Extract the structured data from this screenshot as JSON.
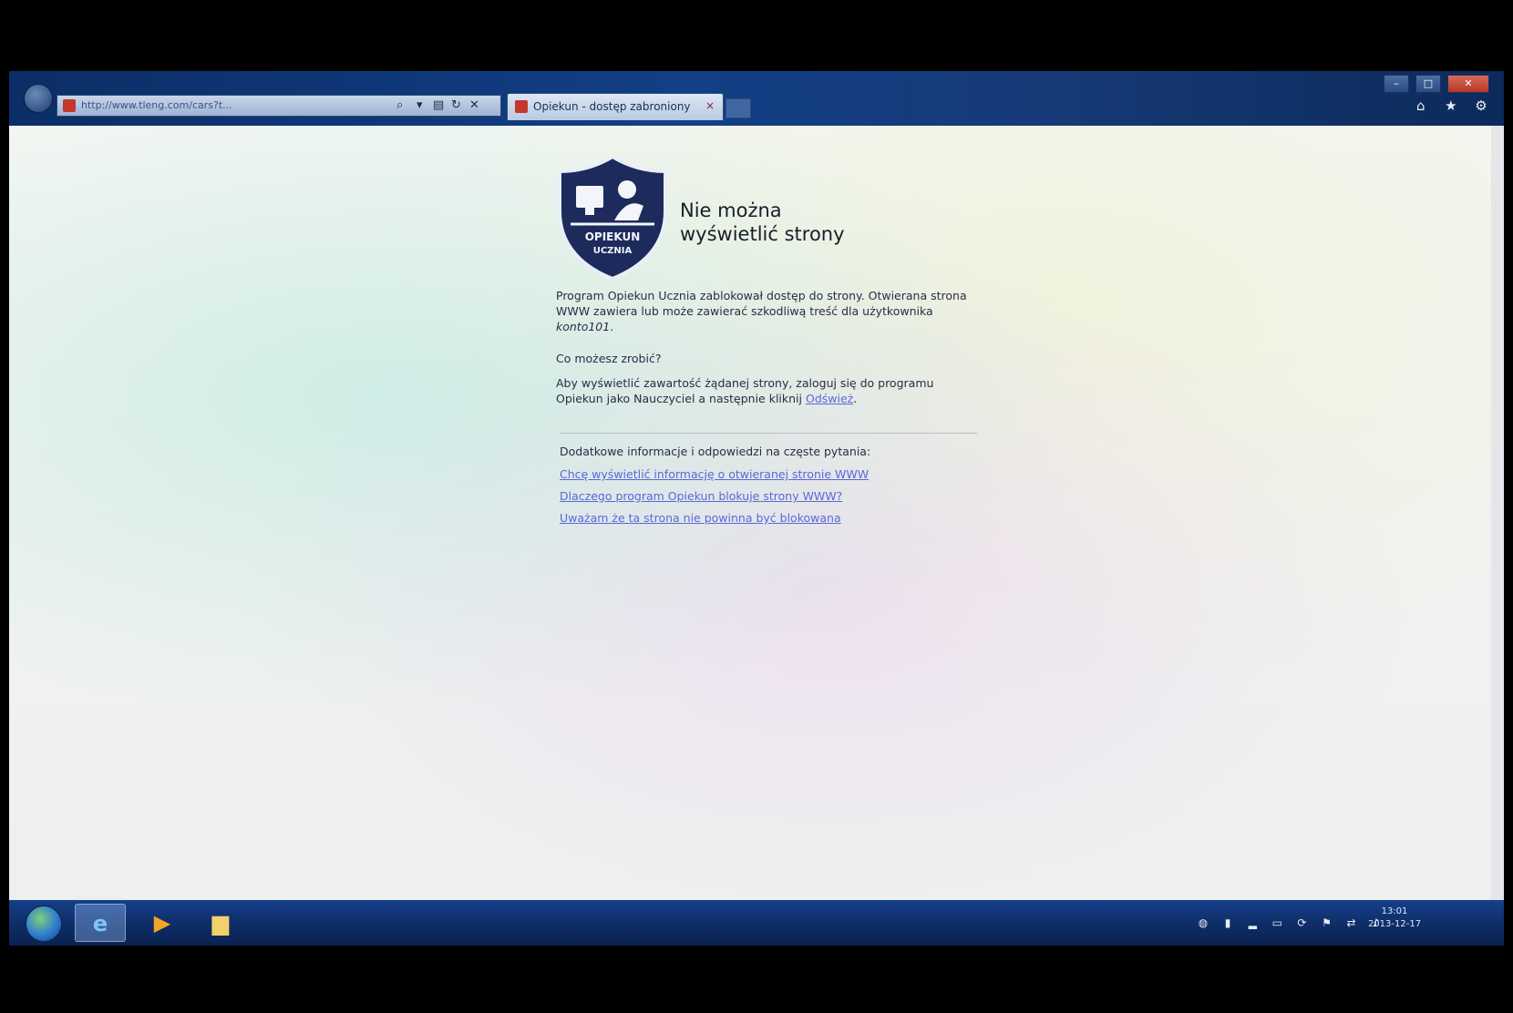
{
  "browser": {
    "address_url": "http://www.tleng.com/cars?t...",
    "tab_label": "Opiekun - dostęp zabroniony",
    "tab_close": "×",
    "window_controls": {
      "minimize": "–",
      "maximize": "□",
      "close": "✕"
    },
    "icons": [
      "home-icon",
      "favorites-star-icon",
      "settings-gear-icon"
    ]
  },
  "page": {
    "shield_text": [
      "OPIEKUN",
      "UCZNIA"
    ],
    "title_line1": "Nie można",
    "title_line2": "wyświetlić strony",
    "para1_text": "Program Opiekun Ucznia zablokował dostęp do strony. Otwierana strona WWW zawiera lub może zawierać szkodliwą treść dla użytkownika ",
    "para1_user": "konto101",
    "para1_end": ".",
    "para2": "Co możesz zrobić?",
    "para3_text": "Aby wyświetlić zawartość żądanej strony, zaloguj się do programu Opiekun jako Nauczyciel a następnie kliknij ",
    "para3_link": "Odśwież",
    "para3_end": ".",
    "faq_heading": "Dodatkowe informacje i odpowiedzi na częste pytania:",
    "faq_links": [
      "Chcę wyświetlić informację o otwieranej stronie WWW",
      "Dlaczego program Opiekun blokuje strony WWW?",
      "Uważam że ta strona nie powinna być blokowana"
    ]
  },
  "taskbar": {
    "pinned": [
      "internet-explorer-icon",
      "media-player-icon",
      "file-explorer-icon"
    ],
    "clock_time": "13:01",
    "clock_date": "2013-12-17"
  },
  "colors": {
    "link": "#5a68d8",
    "shield": "#1d2a5c",
    "taskbar": "#0e2d66"
  }
}
